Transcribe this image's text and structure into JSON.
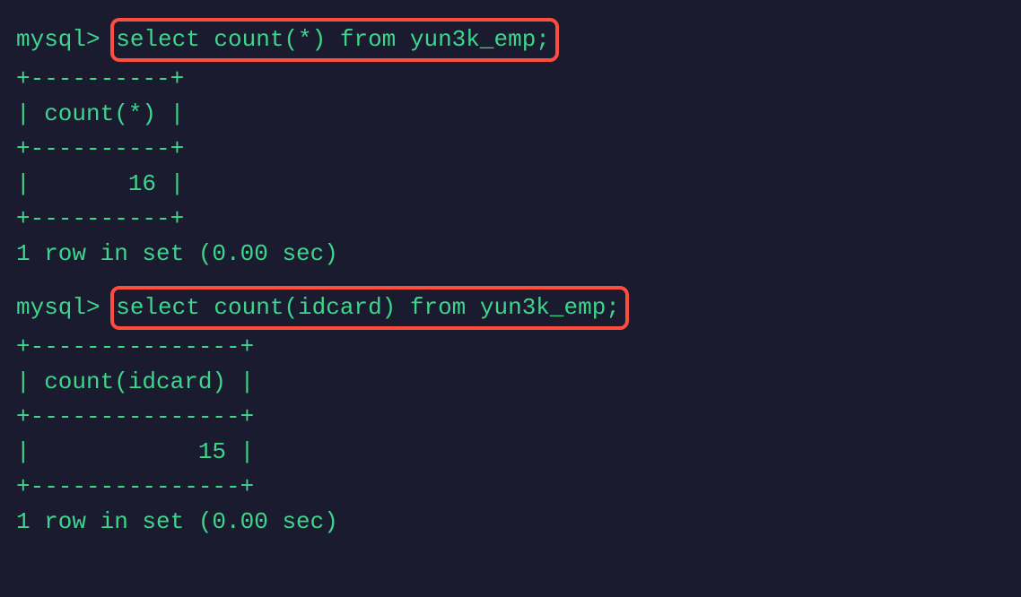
{
  "block1": {
    "prompt": "mysql> ",
    "query": "select count(*) from yun3k_emp;",
    "border_top": "+----------+",
    "header": "| count(*) |",
    "border_mid": "+----------+",
    "value": "|       16 |",
    "border_bot": "+----------+",
    "status": "1 row in set (0.00 sec)"
  },
  "block2": {
    "prompt": "mysql> ",
    "query": "select count(idcard) from yun3k_emp;",
    "border_top": "+---------------+",
    "header": "| count(idcard) |",
    "border_mid": "+---------------+",
    "value": "|            15 |",
    "border_bot": "+---------------+",
    "status": "1 row in set (0.00 sec)"
  }
}
